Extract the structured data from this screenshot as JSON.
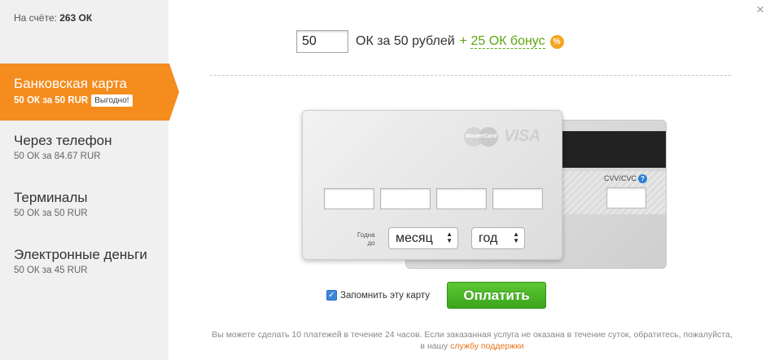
{
  "sidebar": {
    "balance_label": "На счёте:",
    "balance_value": "263 ОК",
    "items": [
      {
        "title": "Банковская карта",
        "sub": "50 ОК за 50 RUR",
        "badge": "Выгодно!",
        "active": true
      },
      {
        "title": "Через телефон",
        "sub": "50 ОК за 84.67 RUR"
      },
      {
        "title": "Терминалы",
        "sub": "50 ОК за 50 RUR"
      },
      {
        "title": "Электронные деньги",
        "sub": "50 ОК за 45 RUR"
      }
    ]
  },
  "header": {
    "amount_value": "50",
    "amount_text": "ОК за 50 рублей",
    "bonus_plus": "+",
    "bonus_text": "25 ОК бонус",
    "bonus_icon": "%"
  },
  "card": {
    "mastercard_text": "MasterCard",
    "visa_text": "VISA",
    "valid_label_line1": "Годна",
    "valid_label_line2": "до",
    "month_select": "месяц",
    "year_select": "год",
    "cvv_label": "CVV/CVC",
    "cvv_help": "?"
  },
  "footer": {
    "remember_label": "Запомнить эту карту",
    "remember_checked": true,
    "pay_button": "Оплатить",
    "note_text": "Вы можете сделать 10 платежей в течение 24 часов. Если заказанная услуга не оказана в течение суток, обратитесь, пожалуйста, в нашу",
    "note_link": "службу поддержки"
  },
  "close_icon": "×",
  "colors": {
    "accent": "#f48c1e",
    "bonus": "#5fa512",
    "pay_button": "#4bb626",
    "link": "#e8731c"
  }
}
